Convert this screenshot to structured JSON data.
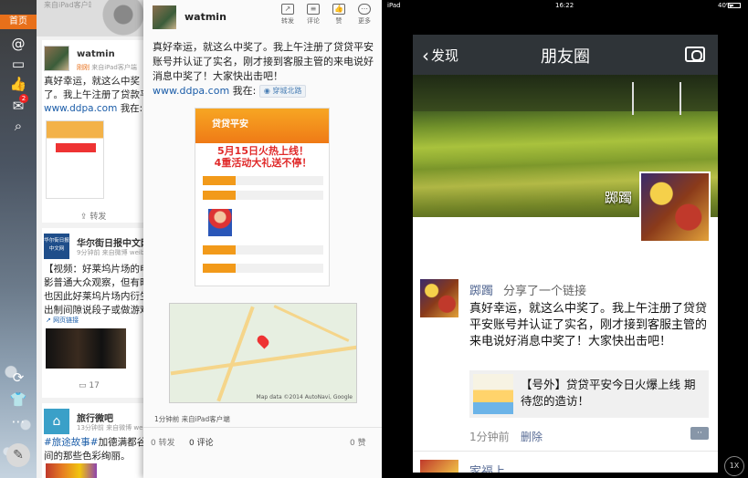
{
  "weibo": {
    "sidebar": {
      "home_tab": "首页",
      "icons": [
        "at-icon",
        "comment-icon",
        "like-icon",
        "mail-icon",
        "search-icon",
        "refresh-icon",
        "shirt-icon",
        "more-icon"
      ],
      "mail_badge": "2"
    },
    "feed": {
      "top_meta": "来自iPad客户端",
      "post1": {
        "user": "watmin",
        "meta_time": "刚刚",
        "meta_source": "来自iPad客户端",
        "text": "真好幸运，就这么中奖了。我上午注册了贷款平安账号并认证了实名，刚才接到客服主管的来电说好消息中奖了！",
        "link": "www.ddpa.com",
        "loc_suffix": "我在:",
        "repost_label": "转发"
      },
      "post2": {
        "logo_text": "华尔街日报中文网",
        "user": "华尔街日报中文网",
        "meta": "9分钟前 来自微博 weibo.com",
        "text": "【视频：好莱坞片场的电影普通大众观察，但有时也因此好莱坞片场内衍生出制间隙说段子或做游戏和",
        "link_tag": "网页链接",
        "count": "17"
      },
      "post3": {
        "user": "旅行微吧",
        "meta": "13分钟前 来自微博 weibo.com",
        "hashtag": "#旅途故事#",
        "text": "加德满都谷间的那些色彩绚丽。"
      }
    },
    "detail": {
      "user": "watmin",
      "toolbar": [
        {
          "icon": "repost-icon",
          "label": "转发"
        },
        {
          "icon": "comment-icon",
          "label": "评论"
        },
        {
          "icon": "like-icon",
          "label": "赞"
        },
        {
          "icon": "more-icon",
          "label": "更多"
        }
      ],
      "text": "真好幸运，就这么中奖了。我上午注册了贷贷平安账号并认证了实名，刚才接到客服主管的来电说好消息中奖了！大家快出击吧！",
      "link": "www.ddpa.com",
      "loc_prefix": "我在:",
      "location_tag": "穿城北路",
      "poster": {
        "banner": "贷贷平安",
        "headline_line1": "5月15日火热上线！",
        "headline_line2": "4重活动大礼送不停！"
      },
      "map_credit": "Map data ©2014 AutoNavi, Google",
      "time": "1分钟前 来自iPad客户端",
      "bar": {
        "repost": "0 转发",
        "comment": "0 评论",
        "like": "0 赞"
      }
    }
  },
  "ipad": {
    "status": {
      "device": "iPad",
      "time": "16:22",
      "battery": "40%",
      "battery_level": 0.4
    },
    "wechat": {
      "back_label": "发现",
      "title": "朋友圈",
      "cover_name": "踯躅",
      "post": {
        "user": "踯躅",
        "action": "分享了一个链接",
        "text": "真好幸运，就这么中奖了。我上午注册了贷贷平安账号并认证了实名，刚才接到客服主管的来电说好消息中奖了！大家快出击吧！",
        "link_title": "【号外】贷贷平安今日火爆上线  期待您的造访！",
        "time": "1分钟前",
        "delete": "删除"
      },
      "next_user": "家福上"
    },
    "zoom": "1X"
  }
}
